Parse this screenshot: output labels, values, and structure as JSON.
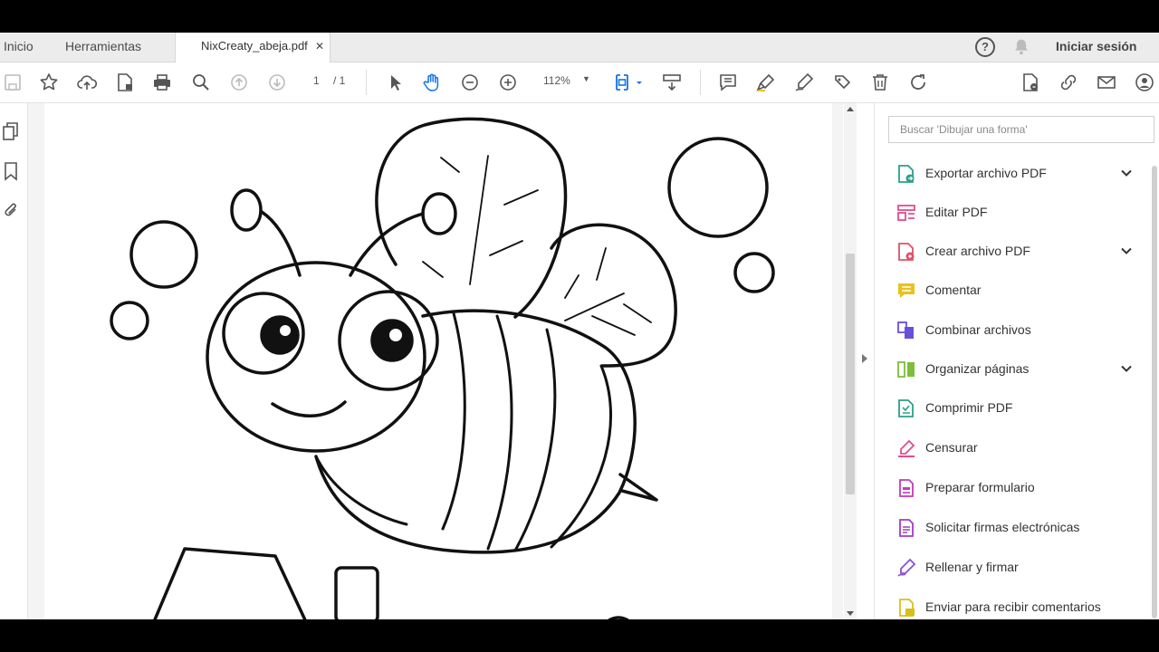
{
  "tabs": {
    "home": "Inicio",
    "tools": "Herramientas",
    "document": "NixCreaty_abeja.pdf",
    "close": "✕"
  },
  "header": {
    "sign_in": "Iniciar sesión",
    "help": "?"
  },
  "toolbar": {
    "page_current": "1",
    "page_total": "/ 1",
    "zoom": "112%"
  },
  "right_panel": {
    "search_placeholder": "Buscar 'Dibujar una forma'",
    "tools": [
      {
        "label": "Exportar archivo PDF",
        "icon": "export-pdf-icon",
        "color": "#2c9f8a",
        "expandable": true
      },
      {
        "label": "Editar PDF",
        "icon": "edit-pdf-icon",
        "color": "#e24d8e",
        "expandable": false
      },
      {
        "label": "Crear archivo PDF",
        "icon": "create-pdf-icon",
        "color": "#e0506a",
        "expandable": true
      },
      {
        "label": "Comentar",
        "icon": "comment-icon",
        "color": "#e9c21c",
        "expandable": false
      },
      {
        "label": "Combinar archivos",
        "icon": "combine-files-icon",
        "color": "#6a4fd8",
        "expandable": false
      },
      {
        "label": "Organizar páginas",
        "icon": "organize-pages-icon",
        "color": "#7dbe3a",
        "expandable": true
      },
      {
        "label": "Comprimir PDF",
        "icon": "compress-pdf-icon",
        "color": "#2c9f8a",
        "expandable": false
      },
      {
        "label": "Censurar",
        "icon": "redact-icon",
        "color": "#e24d8e",
        "expandable": false
      },
      {
        "label": "Preparar formulario",
        "icon": "prepare-form-icon",
        "color": "#c33bb8",
        "expandable": false
      },
      {
        "label": "Solicitar firmas electrónicas",
        "icon": "request-signatures-icon",
        "color": "#a23bc3",
        "expandable": false
      },
      {
        "label": "Rellenar y firmar",
        "icon": "fill-sign-icon",
        "color": "#8b4fd8",
        "expandable": false
      },
      {
        "label": "Enviar para recibir comentarios",
        "icon": "send-for-comments-icon",
        "color": "#d6c01c",
        "expandable": false
      }
    ]
  },
  "colors": {
    "accent_blue": "#1473e6",
    "chrome_bg": "#ececec"
  }
}
